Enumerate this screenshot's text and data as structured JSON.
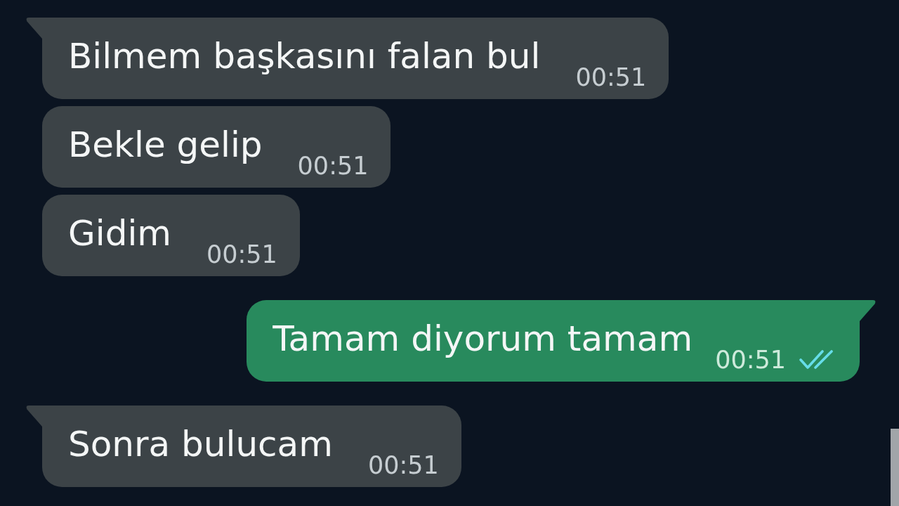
{
  "messages": [
    {
      "kind": "incoming",
      "tail": true,
      "text": "Bilmem başkasını falan bul",
      "time": "00:51"
    },
    {
      "kind": "incoming",
      "tail": false,
      "text": "Bekle gelip",
      "time": "00:51"
    },
    {
      "kind": "incoming",
      "tail": false,
      "text": "Gidim",
      "time": "00:51"
    },
    {
      "kind": "outgoing",
      "tail": true,
      "text": "Tamam diyorum tamam",
      "time": "00:51",
      "read": true
    },
    {
      "kind": "incoming",
      "tail": true,
      "text": "Sonra bulucam",
      "time": "00:51"
    }
  ]
}
